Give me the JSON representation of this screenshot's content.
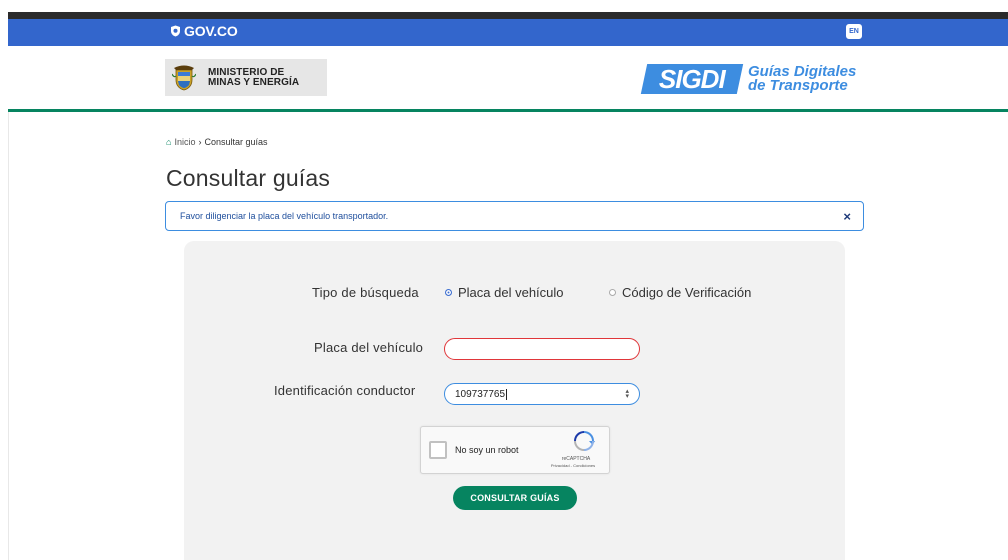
{
  "gov_bar": {
    "logo_text": "GOV.CO",
    "lang_label": "EN"
  },
  "header": {
    "ministry_line1": "MINISTERIO DE",
    "ministry_line2": "MINAS Y ENERGÍA",
    "sigdi_badge": "SIGDI",
    "sigdi_line1": "Guías Digitales",
    "sigdi_line2": "de Transporte"
  },
  "breadcrumb": {
    "home": "Inicio",
    "separator": "›",
    "current": "Consultar guías"
  },
  "page": {
    "title": "Consultar guías"
  },
  "alert": {
    "message": "Favor diligenciar la placa del vehículo transportador.",
    "close": "×"
  },
  "form": {
    "search_type_label": "Tipo de búsqueda",
    "search_type_options": [
      {
        "label": "Placa del vehículo",
        "selected": true
      },
      {
        "label": "Código de Verificación",
        "selected": false
      }
    ],
    "plate_label": "Placa del vehículo",
    "plate_value": "",
    "driver_id_label": "Identificación conductor",
    "driver_id_value": "109737765",
    "captcha_label": "No soy un robot",
    "captcha_brand": "reCAPTCHA",
    "captcha_links": "Privacidad - Condiciones",
    "submit_label": "CONSULTAR GUÍAS"
  },
  "colors": {
    "gov_blue": "#3366cc",
    "primary_green": "#068460",
    "error_red": "#e0363a",
    "alert_blue": "#3d8de0"
  }
}
